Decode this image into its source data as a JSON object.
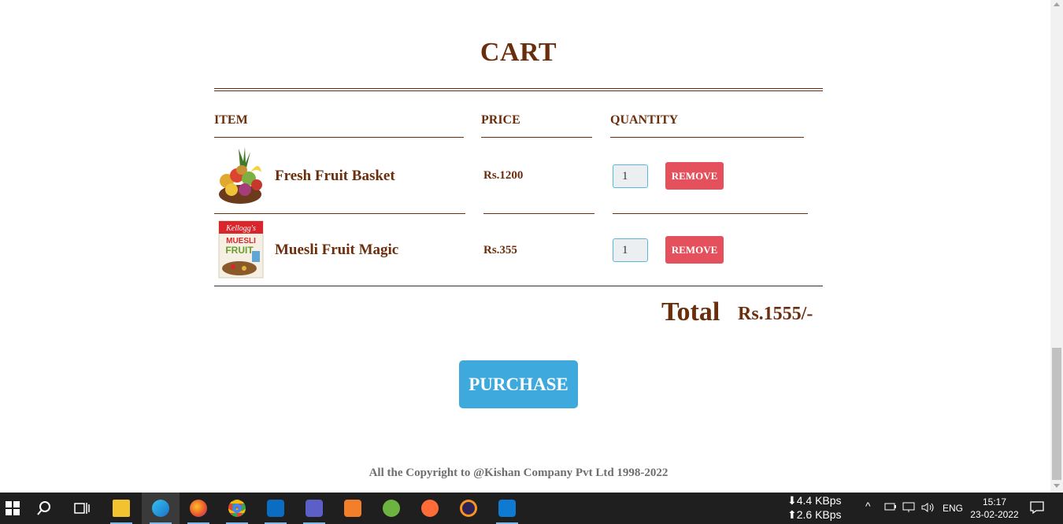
{
  "cart": {
    "title": "CART",
    "headers": {
      "item": "ITEM",
      "price": "PRICE",
      "quantity": "QUANTITY"
    },
    "items": [
      {
        "name": "Fresh Fruit Basket",
        "price": "Rs.1200",
        "quantity": "1",
        "remove_label": "REMOVE",
        "image_icon": "fruit-basket-image"
      },
      {
        "name": "Muesli Fruit Magic",
        "price": "Rs.355",
        "quantity": "1",
        "remove_label": "REMOVE",
        "image_icon": "muesli-box-image"
      }
    ],
    "total_label": "Total",
    "total_value": "Rs.1555/-",
    "purchase_label": "PURCHASE"
  },
  "footer": {
    "copyright": "All the Copyright to @Kishan Company Pvt Ltd 1998-2022"
  },
  "colors": {
    "brand_text": "#6b2e0c",
    "remove": "#e4515d",
    "purchase": "#3ea9dc"
  },
  "taskbar": {
    "apps": [
      "windows-start-icon",
      "search-icon",
      "task-view-icon",
      "file-explorer-icon",
      "edge-icon",
      "firefox-icon",
      "chrome-icon",
      "outlook-icon",
      "teams-icon",
      "xampp-icon",
      "spring-icon",
      "postman-icon",
      "eclipse-icon",
      "vscode-icon"
    ],
    "net_down": "⬇4.4 KBps",
    "net_up": "⬆2.6 KBps",
    "language": "ENG",
    "time": "15:17",
    "date": "23-02-2022"
  }
}
